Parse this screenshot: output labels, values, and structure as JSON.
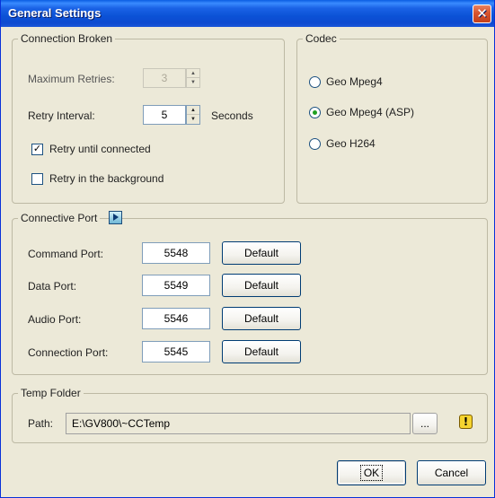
{
  "window": {
    "title": "General Settings",
    "close_glyph": "✕"
  },
  "connection_broken": {
    "title": "Connection Broken",
    "max_retries_label": "Maximum Retries:",
    "max_retries_value": "3",
    "retry_interval_label": "Retry Interval:",
    "retry_interval_value": "5",
    "seconds_label": "Seconds",
    "retry_until_connected": {
      "label": "Retry until connected",
      "checked": true
    },
    "retry_background": {
      "label": "Retry in the background",
      "checked": false
    }
  },
  "codec": {
    "title": "Codec",
    "options": [
      "Geo Mpeg4",
      "Geo Mpeg4 (ASP)",
      "Geo H264"
    ],
    "selected": "Geo Mpeg4 (ASP)"
  },
  "connective_port": {
    "title": "Connective Port",
    "icon": "arrow-right-icon",
    "default_label": "Default",
    "ports": [
      {
        "label": "Command Port:",
        "value": "5548"
      },
      {
        "label": "Data Port:",
        "value": "5549"
      },
      {
        "label": "Audio Port:",
        "value": "5546"
      },
      {
        "label": "Connection Port:",
        "value": "5545"
      }
    ]
  },
  "temp_folder": {
    "title": "Temp Folder",
    "path_label": "Path:",
    "path_value": "E:\\GV800\\~CCTemp",
    "browse_label": "...",
    "warning_glyph": "!"
  },
  "footer": {
    "ok_label": "OK",
    "cancel_label": "Cancel"
  }
}
